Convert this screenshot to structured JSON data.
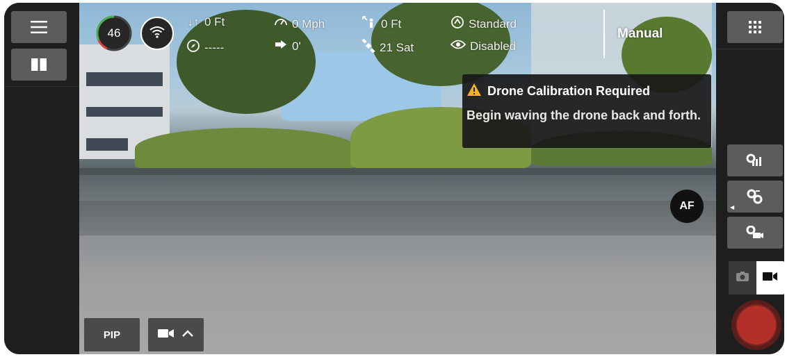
{
  "telemetry": {
    "battery": "46",
    "altitude": "0 Ft",
    "heading": "-----",
    "speed": "0 Mph",
    "speed_secondary": "0'",
    "distance": "0 Ft",
    "satellites": "21 Sat",
    "flight_profile": "Standard",
    "obstacle_avoidance": "Disabled"
  },
  "mode": {
    "label": "Manual"
  },
  "alert": {
    "title": "Drone Calibration Required",
    "message": "Begin waving the drone back and forth.",
    "color": "#f2b51c"
  },
  "camera": {
    "af_label": "AF"
  },
  "bottom": {
    "pip_label": "PIP"
  },
  "icons": {
    "menu": "menu-icon",
    "split": "split-view-icon",
    "grid": "grid-icon",
    "wifi": "wifi-icon",
    "settings": [
      "gimbal-settings-icon",
      "drone-settings-icon",
      "camera-settings-icon"
    ],
    "photo": "camera-icon",
    "video": "video-icon",
    "record": "record-button"
  },
  "colors": {
    "record": "#b2302a",
    "battery_arc": "#4caf50"
  }
}
